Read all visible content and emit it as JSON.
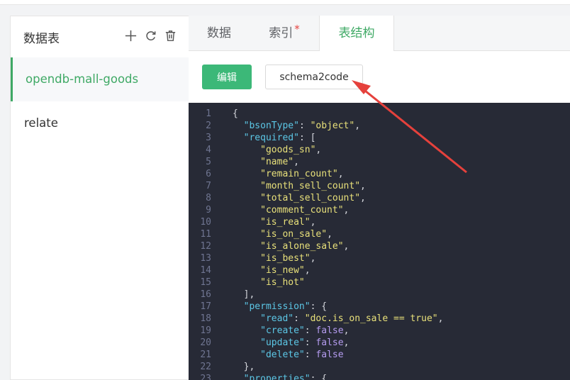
{
  "sidebar": {
    "title": "数据表",
    "tools": [
      "add-icon",
      "refresh-icon",
      "trash-icon"
    ],
    "items": [
      {
        "label": "opendb-mall-goods",
        "active": true
      },
      {
        "label": "relate",
        "active": false
      }
    ]
  },
  "tabs": [
    {
      "label": "数据",
      "active": false
    },
    {
      "label": "索引",
      "active": false,
      "marker": "*"
    },
    {
      "label": "表结构",
      "active": true
    }
  ],
  "toolbar": {
    "edit_label": "编辑",
    "schema2code_label": "schema2code"
  },
  "editor": {
    "lines": [
      {
        "n": "1",
        "tokens": [
          [
            "p",
            "{"
          ]
        ]
      },
      {
        "n": "2",
        "tokens": [
          [
            "p",
            "  "
          ],
          [
            "k",
            "\"bsonType\""
          ],
          [
            "p",
            ": "
          ],
          [
            "s",
            "\"object\""
          ],
          [
            "p",
            ","
          ]
        ]
      },
      {
        "n": "3",
        "tokens": [
          [
            "p",
            "  "
          ],
          [
            "k",
            "\"required\""
          ],
          [
            "p",
            ": ["
          ]
        ]
      },
      {
        "n": "4",
        "tokens": [
          [
            "p",
            "     "
          ],
          [
            "s",
            "\"goods_sn\""
          ],
          [
            "p",
            ","
          ]
        ]
      },
      {
        "n": "5",
        "tokens": [
          [
            "p",
            "     "
          ],
          [
            "s",
            "\"name\""
          ],
          [
            "p",
            ","
          ]
        ]
      },
      {
        "n": "6",
        "tokens": [
          [
            "p",
            "     "
          ],
          [
            "s",
            "\"remain_count\""
          ],
          [
            "p",
            ","
          ]
        ]
      },
      {
        "n": "7",
        "tokens": [
          [
            "p",
            "     "
          ],
          [
            "s",
            "\"month_sell_count\""
          ],
          [
            "p",
            ","
          ]
        ]
      },
      {
        "n": "8",
        "tokens": [
          [
            "p",
            "     "
          ],
          [
            "s",
            "\"total_sell_count\""
          ],
          [
            "p",
            ","
          ]
        ]
      },
      {
        "n": "9",
        "tokens": [
          [
            "p",
            "     "
          ],
          [
            "s",
            "\"comment_count\""
          ],
          [
            "p",
            ","
          ]
        ]
      },
      {
        "n": "10",
        "tokens": [
          [
            "p",
            "     "
          ],
          [
            "s",
            "\"is_real\""
          ],
          [
            "p",
            ","
          ]
        ]
      },
      {
        "n": "11",
        "tokens": [
          [
            "p",
            "     "
          ],
          [
            "s",
            "\"is_on_sale\""
          ],
          [
            "p",
            ","
          ]
        ]
      },
      {
        "n": "12",
        "tokens": [
          [
            "p",
            "     "
          ],
          [
            "s",
            "\"is_alone_sale\""
          ],
          [
            "p",
            ","
          ]
        ]
      },
      {
        "n": "13",
        "tokens": [
          [
            "p",
            "     "
          ],
          [
            "s",
            "\"is_best\""
          ],
          [
            "p",
            ","
          ]
        ]
      },
      {
        "n": "14",
        "tokens": [
          [
            "p",
            "     "
          ],
          [
            "s",
            "\"is_new\""
          ],
          [
            "p",
            ","
          ]
        ]
      },
      {
        "n": "15",
        "tokens": [
          [
            "p",
            "     "
          ],
          [
            "s",
            "\"is_hot\""
          ]
        ]
      },
      {
        "n": "16",
        "tokens": [
          [
            "p",
            "  ],"
          ]
        ]
      },
      {
        "n": "17",
        "tokens": [
          [
            "p",
            "  "
          ],
          [
            "k",
            "\"permission\""
          ],
          [
            "p",
            ": {"
          ]
        ]
      },
      {
        "n": "18",
        "tokens": [
          [
            "p",
            "     "
          ],
          [
            "k",
            "\"read\""
          ],
          [
            "p",
            ": "
          ],
          [
            "s",
            "\"doc.is_on_sale == true\""
          ],
          [
            "p",
            ","
          ]
        ]
      },
      {
        "n": "19",
        "tokens": [
          [
            "p",
            "     "
          ],
          [
            "k",
            "\"create\""
          ],
          [
            "p",
            ": "
          ],
          [
            "b",
            "false"
          ],
          [
            "p",
            ","
          ]
        ]
      },
      {
        "n": "20",
        "tokens": [
          [
            "p",
            "     "
          ],
          [
            "k",
            "\"update\""
          ],
          [
            "p",
            ": "
          ],
          [
            "b",
            "false"
          ],
          [
            "p",
            ","
          ]
        ]
      },
      {
        "n": "21",
        "tokens": [
          [
            "p",
            "     "
          ],
          [
            "k",
            "\"delete\""
          ],
          [
            "p",
            ": "
          ],
          [
            "b",
            "false"
          ]
        ]
      },
      {
        "n": "22",
        "tokens": [
          [
            "p",
            "  },"
          ]
        ]
      },
      {
        "n": "23",
        "tokens": [
          [
            "p",
            "  "
          ],
          [
            "k",
            "\"properties\""
          ],
          [
            "p",
            ": {"
          ]
        ]
      }
    ]
  },
  "colors": {
    "accent": "#3cb878",
    "active_text": "#3fa965",
    "editor_bg": "#272a36",
    "annotation": "#e5413c"
  }
}
